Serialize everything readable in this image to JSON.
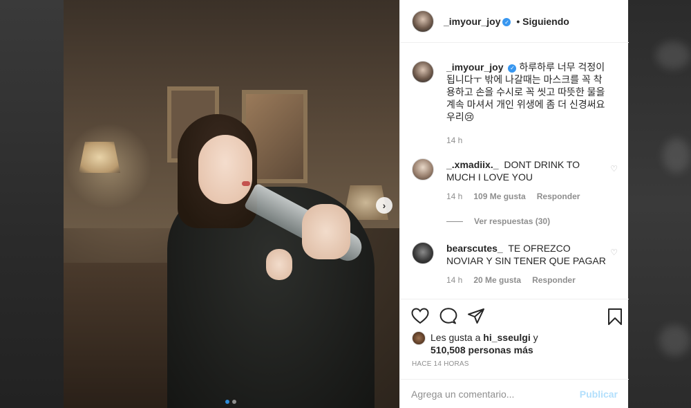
{
  "post": {
    "author": "_imyour_joy",
    "follow_label": "• Siguiendo",
    "caption": "하루하루 너무 걱정이 됩니다ㅜ 밖에 나갈때는 마스크를 꼭 착용하고 손을 수시로 꼭 씻고 따뜻한 물을 계속 마셔서 개인 위생에 좀 더 신경써요 우리😢",
    "caption_time": "14 h"
  },
  "comments": [
    {
      "user": "_.xmadiix._",
      "text": "DONT DRINK TO MUCH I LOVE YOU",
      "time": "14 h",
      "likes": "109 Me gusta",
      "reply": "Responder"
    },
    {
      "user": "bearscutes_",
      "text": "TE OFREZCO NOVIAR Y SIN TENER QUE PAGAR",
      "time": "14 h",
      "likes": "20 Me gusta",
      "reply": "Responder"
    }
  ],
  "view_replies": "Ver respuestas (30)",
  "likes": {
    "prefix": "Les gusta a",
    "user": "hi_sseulgi",
    "mid": "y",
    "count": "510,508 personas más"
  },
  "time_ago": "HACE 14 HORAS",
  "comment_box": {
    "placeholder": "Agrega un comentario...",
    "publish": "Publicar"
  },
  "carousel": {
    "active_index": 0,
    "total": 2
  },
  "icons": {
    "heart": "heart-icon",
    "comment": "comment-icon",
    "share": "share-icon",
    "save": "bookmark-icon",
    "next": "chevron-right-icon",
    "verified": "verified-badge-icon"
  },
  "colors": {
    "verified": "#3897f0",
    "publish_disabled": "#b2dffc",
    "dot_active": "#2f8bd8"
  }
}
